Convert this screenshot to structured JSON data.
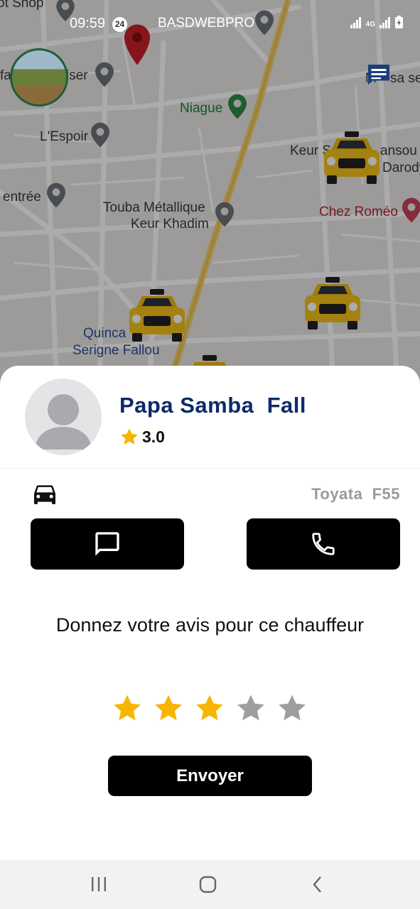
{
  "status_bar": {
    "time": "09:59",
    "notification_count": "24",
    "carrier": "BASDWEBPRO",
    "network": "4G"
  },
  "map": {
    "labels": [
      {
        "text": "ot Shop",
        "kind": "normal"
      },
      {
        "text": "fa",
        "kind": "normal"
      },
      {
        "text": "iser",
        "kind": "normal"
      },
      {
        "text": "Niague",
        "kind": "green"
      },
      {
        "text": "L'Espoir",
        "kind": "normal"
      },
      {
        "text": "Keur S",
        "kind": "normal"
      },
      {
        "text": "ansou",
        "kind": "normal"
      },
      {
        "text": "Darody",
        "kind": "normal"
      },
      {
        "text": "entrée",
        "kind": "normal"
      },
      {
        "text": "Touba Métallique",
        "kind": "normal"
      },
      {
        "text": "Keur Khadim",
        "kind": "normal"
      },
      {
        "text": "Chez Roméo",
        "kind": "red"
      },
      {
        "text": "Quinca",
        "kind": "blue"
      },
      {
        "text": "Serigne Fallou",
        "kind": "blue"
      },
      {
        "text": "M",
        "kind": "normal"
      },
      {
        "text": "sa se",
        "kind": "normal"
      }
    ]
  },
  "driver": {
    "name": "Papa Samba  Fall",
    "rating": "3.0",
    "vehicle": "Toyata  F55"
  },
  "review": {
    "prompt": "Donnez votre avis pour ce chauffeur",
    "selected_stars": 3,
    "total_stars": 5,
    "submit_label": "Envoyer"
  },
  "colors": {
    "accent_navy": "#0d2a6b",
    "star_active": "#f7b500",
    "star_inactive": "#9e9e9e",
    "button_bg": "#000000"
  }
}
